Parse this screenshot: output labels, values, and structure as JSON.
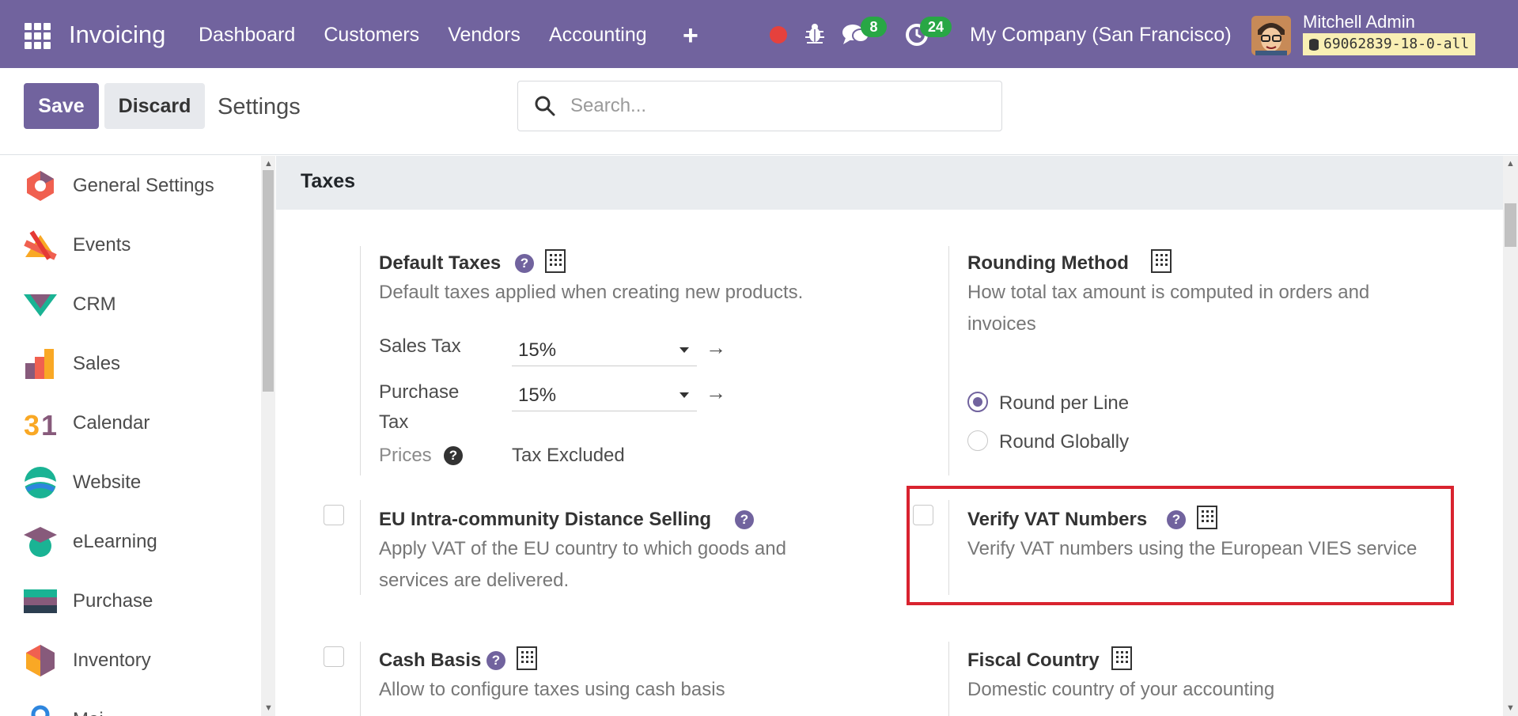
{
  "navbar": {
    "brand": "Invoicing",
    "menu": [
      "Dashboard",
      "Customers",
      "Vendors",
      "Accounting"
    ],
    "messages_count": "8",
    "activities_count": "24",
    "company": "My Company (San Francisco)",
    "user_name": "Mitchell Admin",
    "database": "69062839-18-0-all",
    "accent": "#71639e"
  },
  "control": {
    "save_label": "Save",
    "discard_label": "Discard",
    "title": "Settings",
    "search_placeholder": "Search..."
  },
  "sidebar": {
    "items": [
      {
        "label": "General Settings",
        "icon": "general-settings-icon"
      },
      {
        "label": "Events",
        "icon": "events-icon"
      },
      {
        "label": "CRM",
        "icon": "crm-icon"
      },
      {
        "label": "Sales",
        "icon": "sales-icon"
      },
      {
        "label": "Calendar",
        "icon": "calendar-icon"
      },
      {
        "label": "Website",
        "icon": "website-icon"
      },
      {
        "label": "eLearning",
        "icon": "elearning-icon"
      },
      {
        "label": "Purchase",
        "icon": "purchase-icon"
      },
      {
        "label": "Inventory",
        "icon": "inventory-icon"
      },
      {
        "label": "Mai",
        "icon": "maintenance-icon"
      }
    ]
  },
  "section": {
    "title": "Taxes",
    "default_taxes": {
      "title": "Default Taxes",
      "description": "Default taxes applied when creating new products.",
      "sales_tax_label": "Sales Tax",
      "sales_tax_value": "15%",
      "purchase_tax_label_1": "Purchase",
      "purchase_tax_label_2": "Tax",
      "purchase_tax_value": "15%",
      "prices_label": "Prices",
      "prices_value": "Tax Excluded"
    },
    "rounding": {
      "title": "Rounding Method",
      "description_1": "How total tax amount is computed in orders and",
      "description_2": "invoices",
      "option_line": "Round per Line",
      "option_global": "Round Globally",
      "selected": "Round per Line"
    },
    "eu_distance": {
      "title": "EU Intra-community Distance Selling",
      "description_1": "Apply VAT of the EU country to which goods and",
      "description_2": "services are delivered.",
      "checked": false
    },
    "verify_vat": {
      "title": "Verify VAT Numbers",
      "description": "Verify VAT numbers using the European VIES service",
      "checked": false
    },
    "cash_basis": {
      "title": "Cash Basis",
      "description": "Allow to configure taxes using cash basis",
      "checked": false
    },
    "fiscal_country": {
      "title": "Fiscal Country",
      "description": "Domestic country of your accounting"
    }
  }
}
